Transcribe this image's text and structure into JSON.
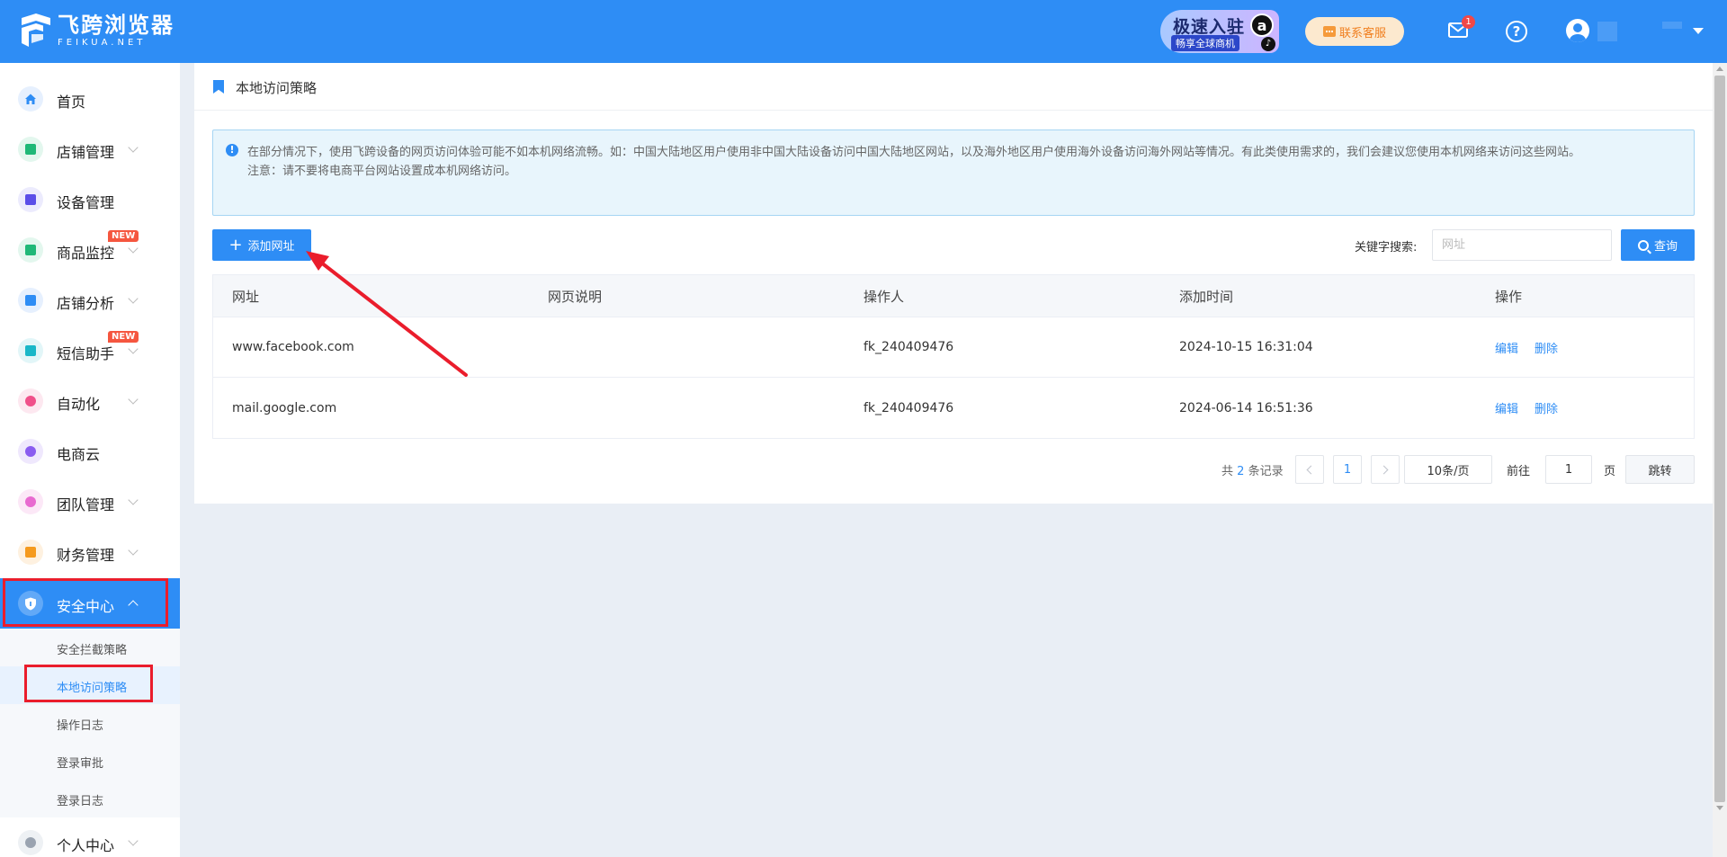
{
  "header": {
    "logo_cn": "飞跨浏览器",
    "logo_en": "FEIKUA.NET",
    "promo_line1": "极速入驻",
    "promo_line2": "畅享全球商机",
    "promo_badge": "a",
    "contact_label": "联系客服",
    "mail_count": "1",
    "help_glyph": "?",
    "brand_color": "#2e8df5"
  },
  "sidebar": {
    "items": [
      {
        "label": "首页",
        "icon": "home-icon",
        "color": "#2e8df5",
        "bg": "#e6f0fe"
      },
      {
        "label": "店铺管理",
        "icon": "store-icon",
        "color": "#1fb877",
        "bg": "#e3f7ee"
      },
      {
        "label": "设备管理",
        "icon": "device-icon",
        "color": "#5b4ee8",
        "bg": "#ecebfd"
      },
      {
        "label": "商品监控",
        "icon": "monitor-icon",
        "color": "#1fb877",
        "bg": "#e3f7ee",
        "badge": "NEW"
      },
      {
        "label": "店铺分析",
        "icon": "analysis-icon",
        "color": "#2e8df5",
        "bg": "#e6f0fe"
      },
      {
        "label": "短信助手",
        "icon": "sms-icon",
        "color": "#19b7c8",
        "bg": "#e2f6f8",
        "badge": "NEW"
      },
      {
        "label": "自动化",
        "icon": "robot-icon",
        "color": "#f0508a",
        "bg": "#fde8f0"
      },
      {
        "label": "电商云",
        "icon": "cloud-icon",
        "color": "#8a5cf0",
        "bg": "#efe8fd"
      },
      {
        "label": "团队管理",
        "icon": "team-icon",
        "color": "#e86ad0",
        "bg": "#fce8f7"
      },
      {
        "label": "财务管理",
        "icon": "wallet-icon",
        "color": "#f59a1e",
        "bg": "#fef1e0"
      },
      {
        "label": "安全中心",
        "icon": "shield-icon",
        "color": "#ffffff",
        "bg": "#5aa6f7"
      },
      {
        "label": "个人中心",
        "icon": "person-icon",
        "color": "#9aa3b0",
        "bg": "#eef1f4"
      }
    ],
    "security_sub": [
      {
        "label": "安全拦截策略"
      },
      {
        "label": "本地访问策略"
      },
      {
        "label": "操作日志"
      },
      {
        "label": "登录审批"
      },
      {
        "label": "登录日志"
      }
    ]
  },
  "page": {
    "title": "本地访问策略",
    "notice_line1": "在部分情况下，使用飞跨设备的网页访问体验可能不如本机网络流畅。如：中国大陆地区用户使用非中国大陆设备访问中国大陆地区网站，以及海外地区用户使用海外设备访问海外网站等情况。有此类使用需求的，我们会建议您使用本机网络来访问这些网站。",
    "notice_line2": "注意：请不要将电商平台网站设置成本机网络访问。",
    "add_button": "添加网址",
    "search_label": "关键字搜索:",
    "search_placeholder": "网址",
    "search_value": "",
    "search_button": "查询"
  },
  "table": {
    "columns": [
      "网址",
      "网页说明",
      "操作人",
      "添加时间",
      "操作"
    ],
    "rows": [
      {
        "url": "www.facebook.com",
        "desc": "",
        "operator": "fk_240409476",
        "time": "2024-10-15 16:31:04",
        "edit": "编辑",
        "delete": "删除"
      },
      {
        "url": "mail.google.com",
        "desc": "",
        "operator": "fk_240409476",
        "time": "2024-06-14 16:51:36",
        "edit": "编辑",
        "delete": "删除"
      }
    ]
  },
  "pagination": {
    "total_prefix": "共",
    "total_count": "2",
    "total_suffix": "条记录",
    "current_page": "1",
    "page_size": "10条/页",
    "goto_label": "前往",
    "goto_value": "1",
    "page_unit": "页",
    "jump_button": "跳转"
  }
}
